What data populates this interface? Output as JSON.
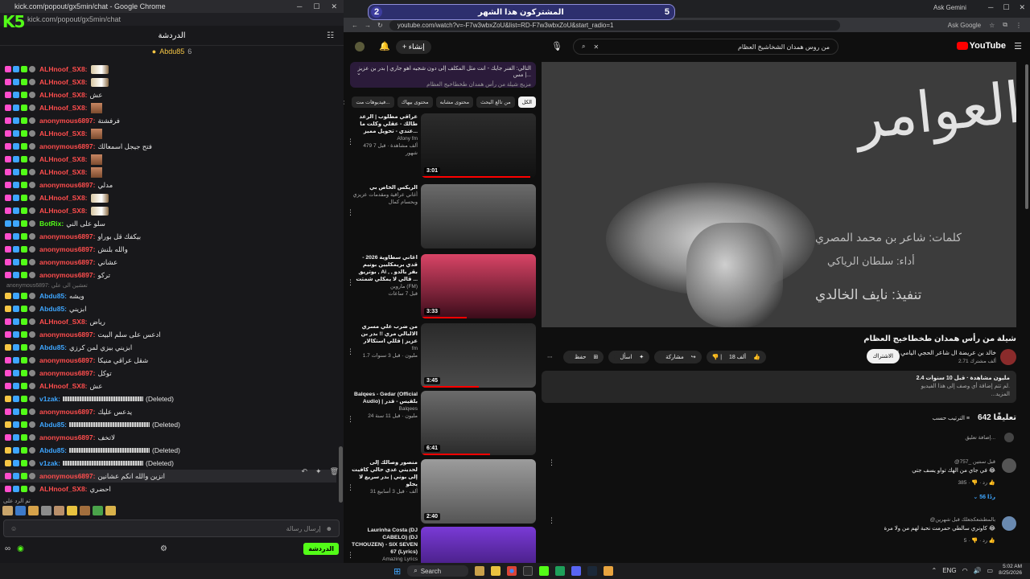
{
  "kick": {
    "window_title": "kick.com/popout/gx5min/chat - Google Chrome",
    "url": "kick.com/popout/gx5min/chat",
    "logo": "K5",
    "chat_title": "الدردشة",
    "pinned_user": "Abdu85",
    "pinned_count": "6",
    "messages": [
      {
        "user": "ALHnoof_SX8",
        "color": "#ff4d4d",
        "text": "",
        "emote": "wing"
      },
      {
        "user": "ALHnoof_SX8",
        "color": "#ff4d4d",
        "text": "",
        "emote": "wing"
      },
      {
        "user": "ALHnoof_SX8",
        "color": "#ff4d4d",
        "text": "عش",
        "emote": ""
      },
      {
        "user": "ALHnoof_SX8",
        "color": "#ff4d4d",
        "text": "",
        "emote": "face"
      },
      {
        "user": "anonymous6897",
        "color": "#ff4d4d",
        "text": "فرفشتة",
        "emote": ""
      },
      {
        "user": "ALHnoof_SX8",
        "color": "#ff4d4d",
        "text": "",
        "emote": "face"
      },
      {
        "user": "anonymous6897",
        "color": "#ff4d4d",
        "text": "فتح جيجل اسمعالك",
        "emote": ""
      },
      {
        "user": "ALHnoof_SX8",
        "color": "#ff4d4d",
        "text": "",
        "emote": "face"
      },
      {
        "user": "ALHnoof_SX8",
        "color": "#ff4d4d",
        "text": "",
        "emote": "face"
      },
      {
        "user": "anonymous6897",
        "color": "#ff4d4d",
        "text": "مدلي",
        "emote": ""
      },
      {
        "user": "ALHnoof_SX8",
        "color": "#ff4d4d",
        "text": "",
        "emote": "wing"
      },
      {
        "user": "ALHnoof_SX8",
        "color": "#ff4d4d",
        "text": "",
        "emote": "wing"
      },
      {
        "user": "BotRix",
        "color": "#53fc18",
        "text": "سلو على الني",
        "emote": ""
      },
      {
        "user": "anonymous6897",
        "color": "#ff4d4d",
        "text": "بيكفك قل بوراو",
        "emote": ""
      },
      {
        "user": "anonymous6897",
        "color": "#ff4d4d",
        "text": "والله بلنش",
        "emote": ""
      },
      {
        "user": "anonymous6897",
        "color": "#ff4d4d",
        "text": "عشاني",
        "emote": ""
      },
      {
        "user": "anonymous6897",
        "color": "#ff4d4d",
        "text": "تركو",
        "emote": ""
      }
    ],
    "sys_line": "anonymous6897: تعشين الى علي",
    "messages2": [
      {
        "user": "Abdu85",
        "color": "#3ea6ff",
        "text": "ويشه",
        "emote": ""
      },
      {
        "user": "Abdu85",
        "color": "#3ea6ff",
        "text": "ابزيني",
        "emote": ""
      },
      {
        "user": "ALHnoof_SX8",
        "color": "#ff4d4d",
        "text": "رياض",
        "emote": ""
      },
      {
        "user": "anonymous6897",
        "color": "#ff4d4d",
        "text": "ادعس على سلم البيت",
        "emote": ""
      },
      {
        "user": "Abdu85",
        "color": "#3ea6ff",
        "text": "ابزيني بيزي لمن كرزي",
        "emote": ""
      },
      {
        "user": "anonymous6897",
        "color": "#ff4d4d",
        "text": "شقل عراقي منيكا",
        "emote": ""
      },
      {
        "user": "anonymous6897",
        "color": "#ff4d4d",
        "text": "توكل",
        "emote": ""
      },
      {
        "user": "ALHnoof_SX8",
        "color": "#ff4d4d",
        "text": "عش",
        "emote": ""
      },
      {
        "user": "v1zak",
        "color": "#3ea6ff",
        "text": "(Deleted)",
        "emote": "scr"
      },
      {
        "user": "anonymous6897",
        "color": "#ff4d4d",
        "text": "يدعس عليك",
        "emote": ""
      },
      {
        "user": "Abdu85",
        "color": "#3ea6ff",
        "text": "(Deleted)",
        "emote": "scr"
      },
      {
        "user": "anonymous6897",
        "color": "#ff4d4d",
        "text": "لاتخف",
        "emote": ""
      },
      {
        "user": "Abdu85",
        "color": "#3ea6ff",
        "text": "(Deleted)",
        "emote": "scr"
      },
      {
        "user": "v1zak",
        "color": "#3ea6ff",
        "text": "(Deleted)",
        "emote": "scr"
      },
      {
        "user": "anonymous6897",
        "color": "#ff4d4d",
        "text": "انزين والله انكم عشانين",
        "emote": ""
      },
      {
        "user": "ALHnoof_SX8",
        "color": "#ff4d4d",
        "text": "احضري",
        "emote": ""
      }
    ],
    "reply_hint": "تم الرد على",
    "input_placeholder": "إرسال رسالة",
    "send_label": "الدردشة"
  },
  "yt": {
    "tab_num_left": "2",
    "tab_label": "المشتركون هذا الشهر",
    "tab_num_right": "5",
    "ask_gemini": "Ask Gemini",
    "ask_google": "Ask Google",
    "url": "youtube.com/watch?v=-F7w3wbxZoU&list=RD-F7w3wbxZoU&start_radio=1",
    "search_query": "من روس همدان الشخاشيخ العظام",
    "create_label": "إنشاء",
    "brand": "YouTube",
    "playlist_title": "التالي: الفنر جايك - انت مثل المكلف إلى دون شجيه اهو جاري | بدر بن عزيز | مس...",
    "playlist_sub": "مزيج شيلة من رأس همدان طخطاخيج العظام",
    "chips": [
      "الكل",
      "من تالع البحث",
      "محتوى مشابه",
      "محتوى بيهاك",
      "فيديوهات مت..."
    ],
    "related": [
      {
        "title": "عراقي مطلوب | الرعد طالك - عقلي وكلت ما عندي - تحويل مميز...",
        "channel": "Afony fm",
        "meta": "479 ألف مشاهدة · قبل 7 شهور",
        "dur": "3:01",
        "bg": "linear-gradient(#2c2c2c,#111)"
      },
      {
        "title": "الريكس الخاص بي",
        "channel": "أغاني عراقية ومقدمات عزيزي وبحسام كمال",
        "meta": "",
        "dur": "",
        "bg": "linear-gradient(#6b6b6b,#2a2a2a)"
      },
      {
        "title": "اغاني سطاوية 2026 - قدي بريمكليين بونيم بوتريق , Ai , بقر بالدو , قالي لا يمكلي شمثت ...",
        "channel": "ماروين (FM)",
        "meta": "قبل 7 ساعات",
        "dur": "3:33",
        "bg": "linear-gradient(#d94466,#3b0c1a)"
      },
      {
        "title": "من ضرب علي مسري الالبالي مري !! بدر بن عزيز | قللي استكالار",
        "channel": "fm",
        "meta": "1.7 مليون · قبل 3 سنوات",
        "dur": "3:45",
        "bg": "linear-gradient(#2a2a2a,#4a4a4a)"
      },
      {
        "title": "Balqees - Gedar (Official Audio) | بلقيس - قدر",
        "channel": "Balqees",
        "meta": "24 مليون · قبل 11 سنة",
        "dur": "6:41",
        "bg": "linear-gradient(#6b6b6b,#2a2a2a)"
      },
      {
        "title": "منصور وصالك إلى لحديني عدي حالي كافيت إلى بوني | بدر سريع لا يجلو",
        "channel": "",
        "meta": "31 ألف · قبل 3 أسابيع",
        "dur": "2:40",
        "bg": "linear-gradient(#9c9c9c,#555)"
      },
      {
        "title": "Laurinha Costa (DJ CABELO) (DJ TCHOUZEN) - SIX SEVEN 67 (Lyrics)",
        "channel": "Amazing Lyrics",
        "meta": "",
        "dur": "",
        "bg": "linear-gradient(#7a3ad6,#2a0f55)"
      }
    ],
    "video_calligraphy": "العوامر",
    "video_cap1": "كلمات: شاعر بن محمد المصري",
    "video_cap2": "أداء: سلطان الرياكي",
    "video_cap3": "تنفيذ: نايف الخالدي",
    "video_title": "شيلة من رأس همدان طخطاخيج العظام",
    "channel_name": "خالد بن عريضة ال شاعر الحجي اليامي المائدي",
    "channel_subs": "2.71 ألف مشترك",
    "subscribe": "الاشتراك",
    "likes": "18 ألف",
    "share": "مشاركة",
    "ask": "اسأل",
    "save": "حفظ",
    "desc_line1": "2.4 مليون مشاهدة · قبل 10 سنوات",
    "desc_line2": "لم تتم إضافة أي وصف إلى هذا الفيديو.",
    "desc_more": "...المزيد",
    "comments_count": "642 تعليقًا",
    "sort_by": "الترتيب حسب",
    "add_comment": "إضافة تعليق...",
    "comments": [
      {
        "handle": "@757_ قبل سنتين",
        "body": "في جاي من الهك تواو يسف جتي 😂",
        "likes": "385",
        "replies": "56 ردًا",
        "color": "#555"
      },
      {
        "handle": "@بالمطشعكجعلك قبل شهرين",
        "body": "كاونري سالطي حمرمت نحبة لهم من ولا مرة 😂",
        "likes": "5",
        "replies": "",
        "color": "#6a8ab0"
      }
    ]
  },
  "taskbar": {
    "search": "Search",
    "time": "5:02 AM",
    "date": "8/25/2026"
  }
}
